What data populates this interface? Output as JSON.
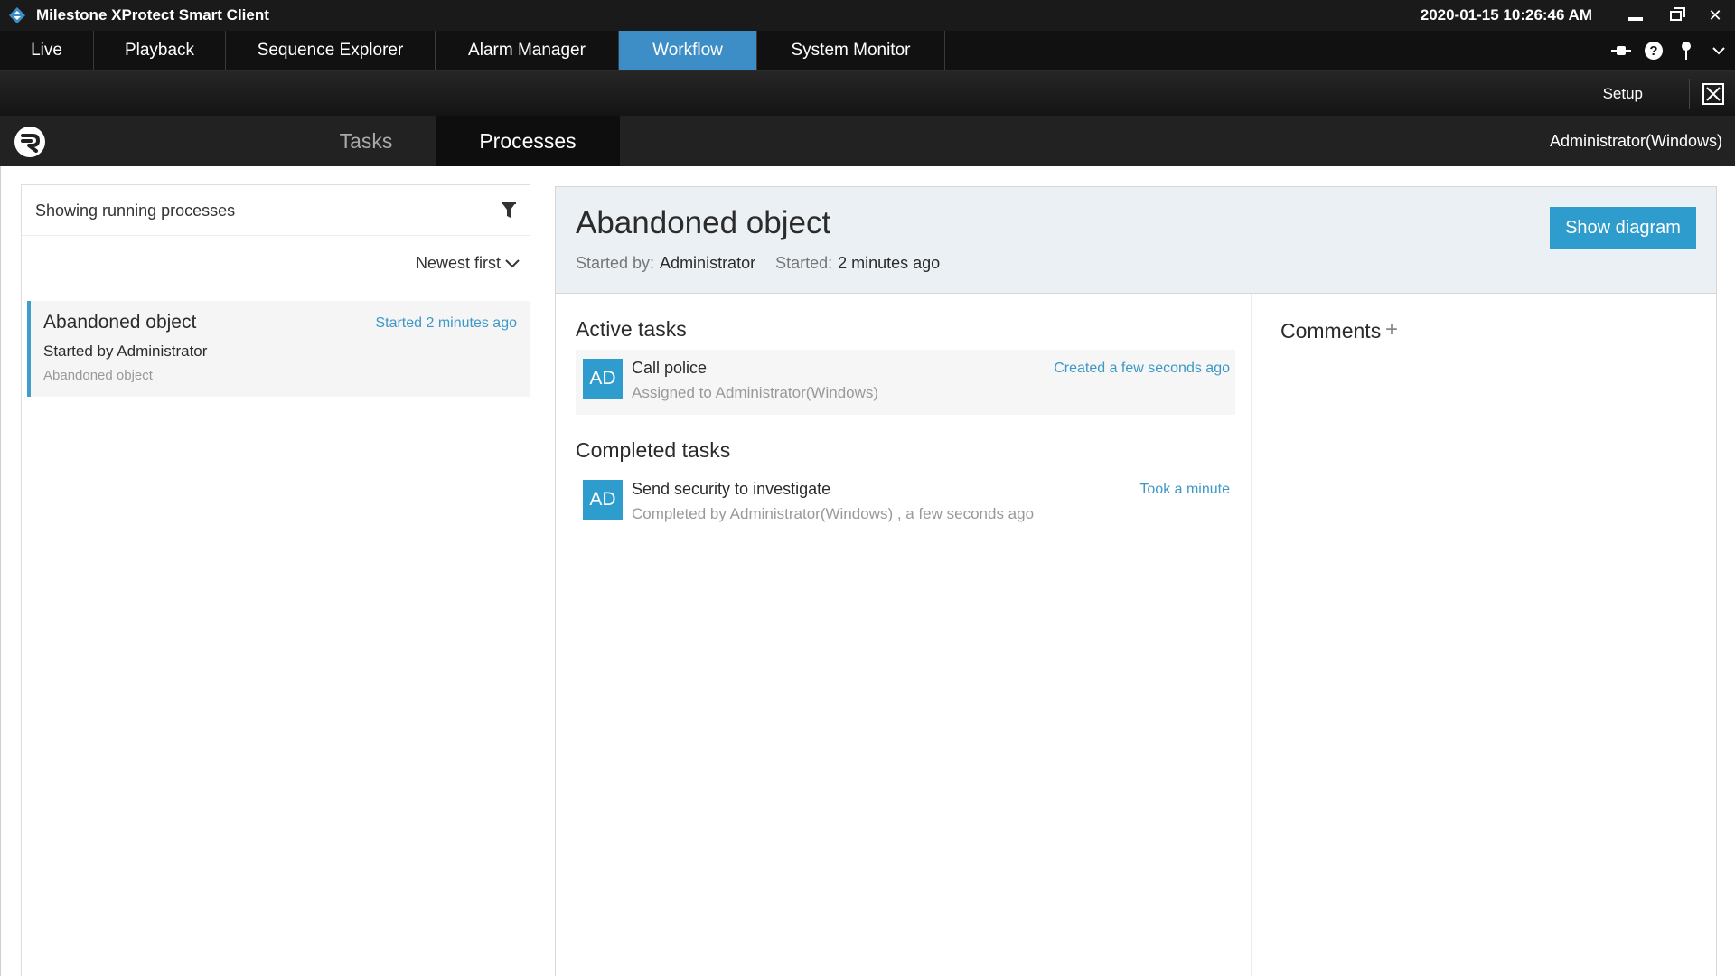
{
  "titlebar": {
    "title": "Milestone XProtect Smart Client",
    "datetime": "2020-01-15 10:26:46 AM",
    "icon": "milestone-logo-icon"
  },
  "mainnav": {
    "tabs": [
      {
        "label": "Live",
        "active": false
      },
      {
        "label": "Playback",
        "active": false
      },
      {
        "label": "Sequence Explorer",
        "active": false
      },
      {
        "label": "Alarm Manager",
        "active": false
      },
      {
        "label": "Workflow",
        "active": true
      },
      {
        "label": "System Monitor",
        "active": false
      }
    ],
    "icons": [
      "connection-icon",
      "help-icon",
      "pin-icon",
      "chevron-down-icon"
    ]
  },
  "setupbar": {
    "setup_label": "Setup"
  },
  "workflow": {
    "tabs": {
      "tasks": "Tasks",
      "processes": "Processes"
    },
    "active_tab": "Processes",
    "user": "Administrator(Windows)"
  },
  "process_list": {
    "filter_text": "Showing running processes",
    "sort_label": "Newest first",
    "items": [
      {
        "title": "Abandoned object",
        "time": "Started 2 minutes ago",
        "started_by": "Started by Administrator",
        "subtitle": "Abandoned object"
      }
    ]
  },
  "process_detail": {
    "title": "Abandoned object",
    "started_by_label": "Started by:",
    "started_by_value": "Administrator",
    "started_label": "Started:",
    "started_value": "2 minutes ago",
    "show_diagram_label": "Show diagram",
    "active_tasks_title": "Active tasks",
    "active_tasks": [
      {
        "avatar": "AD",
        "name": "Call police",
        "sub": "Assigned to Administrator(Windows)",
        "time": "Created a few seconds ago"
      }
    ],
    "completed_tasks_title": "Completed tasks",
    "completed_tasks": [
      {
        "avatar": "AD",
        "name": "Send security to investigate",
        "sub": "Completed by Administrator(Windows) , a few seconds ago",
        "time": "Took a minute"
      }
    ],
    "comments_title": "Comments",
    "comments_add": "+"
  },
  "colors": {
    "accent": "#2e9ccc",
    "nav_active": "#3d8ec6",
    "link": "#3d98c8"
  }
}
